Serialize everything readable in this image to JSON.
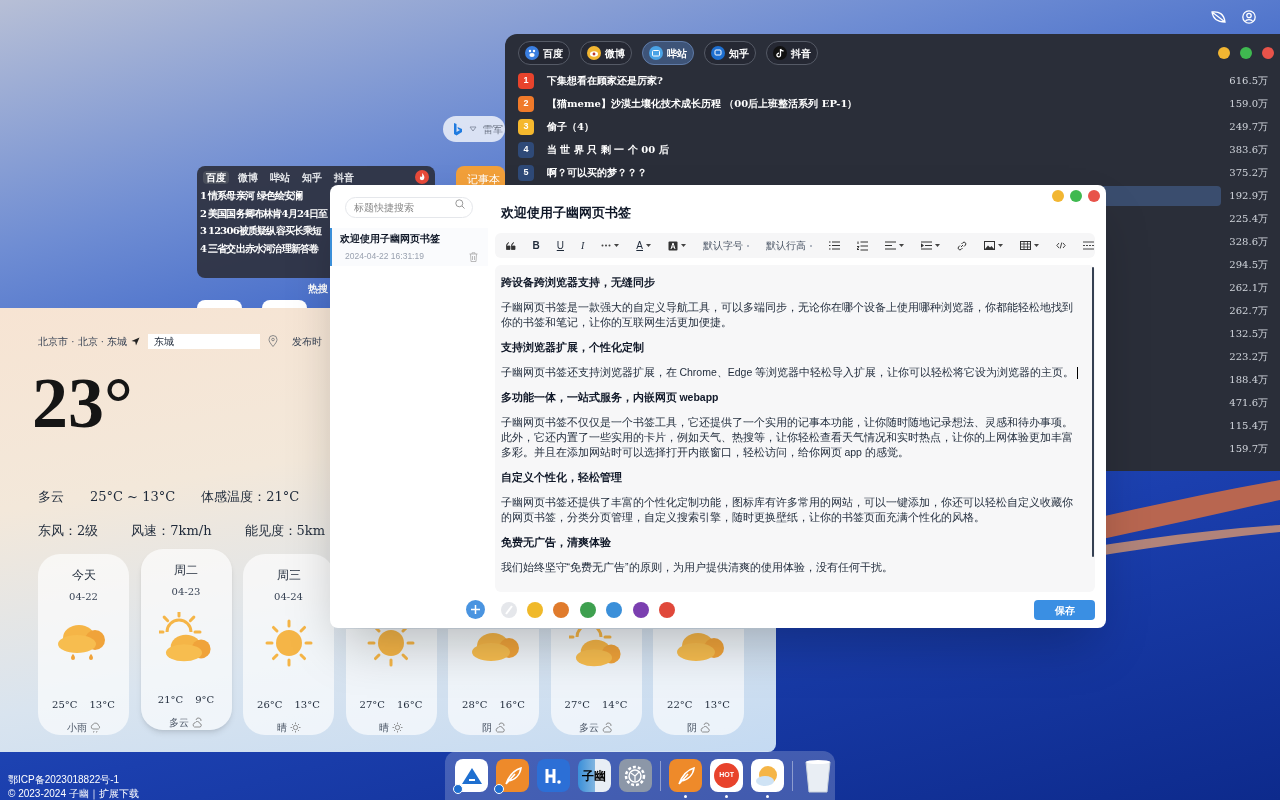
{
  "search_bar": {
    "query": "雷军"
  },
  "notepad_button": {
    "label": "记事本"
  },
  "hot_widget": {
    "tabs": [
      {
        "label": "百度",
        "selected": true
      },
      {
        "label": "微博",
        "selected": false
      },
      {
        "label": "哔站",
        "selected": false
      },
      {
        "label": "知乎",
        "selected": false
      },
      {
        "label": "抖音",
        "selected": false
      }
    ],
    "items": [
      {
        "rank": "1",
        "title": "情系母亲河 绿色绘安澜"
      },
      {
        "rank": "2",
        "title": "美国国务卿布林肯4月24日至"
      },
      {
        "rank": "3",
        "title": "12306被质疑纵容买长乘短"
      },
      {
        "rank": "4",
        "title": "三省交出赤水河治理新答卷"
      }
    ],
    "caption": "热搜"
  },
  "hot_window": {
    "tabs": [
      {
        "label": "百度",
        "selected": false
      },
      {
        "label": "微博",
        "selected": false
      },
      {
        "label": "哔站",
        "selected": true
      },
      {
        "label": "知乎",
        "selected": false
      },
      {
        "label": "抖音",
        "selected": false
      }
    ],
    "items": [
      {
        "rank": "1",
        "color": "#e8432c",
        "title": "下集想看在顾家还是厉家?",
        "heat": "616.5万",
        "selected": false
      },
      {
        "rank": "2",
        "color": "#f07a2a",
        "title": "【猫meme】沙漠土壤化技术成长历程 （00后上班整活系列 EP-1）",
        "heat": "159.0万",
        "selected": false
      },
      {
        "rank": "3",
        "color": "#f5b82e",
        "title": "偷子（4）",
        "heat": "249.7万",
        "selected": false
      },
      {
        "rank": "4",
        "color": "#2f4a78",
        "title": "当 世 界 只 剩 一 个 00 后",
        "heat": "383.6万",
        "selected": false
      },
      {
        "rank": "5",
        "color": "#2f4a78",
        "title": "啊？可以买的梦？？？",
        "heat": "375.2万",
        "selected": false
      },
      {
        "heat": "192.9万",
        "selected": true
      },
      {
        "heat": "225.4万",
        "selected": false
      },
      {
        "heat": "328.6万",
        "selected": false
      },
      {
        "heat": "294.5万",
        "selected": false
      },
      {
        "heat": "262.1万",
        "selected": false
      },
      {
        "heat": "262.7万",
        "selected": false
      },
      {
        "heat": "132.5万",
        "selected": false
      },
      {
        "heat": "223.2万",
        "selected": false
      },
      {
        "heat": "188.4万",
        "selected": false
      },
      {
        "heat": "471.6万",
        "selected": false
      },
      {
        "heat": "115.4万",
        "selected": false
      },
      {
        "heat": "159.7万",
        "selected": false
      }
    ]
  },
  "weather": {
    "location": "北京市 · 北京 · 东城",
    "city_input": "东城",
    "publish_label": "发布时",
    "temperature": "23°",
    "condition": "多云",
    "range": "25°C ~ 13°C",
    "feels_like": "体感温度：21°C",
    "wind": "东风：2级",
    "wind_speed": "风速：7km/h",
    "visibility": "能见度：5km",
    "days": [
      {
        "day": "今天",
        "date": "04-22",
        "kind": "rain",
        "high": "25°C",
        "low": "13°C",
        "label": "小雨",
        "hovered": false
      },
      {
        "day": "周二",
        "date": "04-23",
        "kind": "partly_cloudy",
        "high": "21°C",
        "low": "9°C",
        "label": "多云",
        "hovered": true
      },
      {
        "day": "周三",
        "date": "04-24",
        "kind": "sunny",
        "high": "26°C",
        "low": "13°C",
        "label": "晴",
        "hovered": false
      },
      {
        "kind": "sunny",
        "high": "27°C",
        "low": "16°C",
        "label": "晴",
        "hovered": false
      },
      {
        "kind": "overcast",
        "high": "28°C",
        "low": "16°C",
        "label": "阴",
        "hovered": false
      },
      {
        "kind": "partly_cloudy",
        "high": "27°C",
        "low": "14°C",
        "label": "多云",
        "hovered": false
      },
      {
        "kind": "overcast",
        "high": "22°C",
        "low": "13°C",
        "label": "阴",
        "hovered": false
      }
    ]
  },
  "notes_window": {
    "search_placeholder": "标题快捷搜索",
    "notes": [
      {
        "title": "欢迎使用子幽网页书签",
        "date": "2024-04-22 16:31:19",
        "selected": true
      }
    ],
    "title": "欢迎使用子幽网页书签",
    "toolbar": [
      {
        "kind": "quote",
        "dropdown": false
      },
      {
        "kind": "bold",
        "label": "B",
        "dropdown": false
      },
      {
        "kind": "underline",
        "label": "U",
        "dropdown": false
      },
      {
        "kind": "italic",
        "label": "I",
        "dropdown": false
      },
      {
        "kind": "more",
        "dropdown": true
      },
      {
        "kind": "font_color",
        "label": "A",
        "dropdown": true
      },
      {
        "kind": "highlight",
        "dropdown": true
      },
      {
        "kind": "select",
        "label": "默认字号",
        "dropdown": false
      },
      {
        "kind": "select",
        "label": "默认行高",
        "dropdown": false
      },
      {
        "kind": "bullet_list",
        "dropdown": false
      },
      {
        "kind": "ordered_list",
        "dropdown": false
      },
      {
        "kind": "align",
        "dropdown": true
      },
      {
        "kind": "indent",
        "dropdown": true
      },
      {
        "kind": "link",
        "dropdown": false
      },
      {
        "kind": "image",
        "dropdown": true
      },
      {
        "kind": "table",
        "dropdown": true
      },
      {
        "kind": "code",
        "dropdown": false
      },
      {
        "kind": "divider",
        "dropdown": false
      }
    ],
    "content": [
      {
        "kind": "heading",
        "text": "跨设备跨浏览器支持，无缝同步",
        "caret": false
      },
      {
        "kind": "body",
        "text": "子幽网页书签是一款强大的自定义导航工具，可以多端同步，无论你在哪个设备上使用哪种浏览器，你都能轻松地找到你的书签和笔记，让你的互联网生活更加便捷。",
        "caret": false
      },
      {
        "kind": "heading",
        "text": "支持浏览器扩展，个性化定制",
        "caret": false
      },
      {
        "kind": "body",
        "text": "子幽网页书签还支持浏览器扩展，在 Chrome、Edge 等浏览器中轻松导入扩展，让你可以轻松将它设为浏览器的主页。",
        "caret": true
      },
      {
        "kind": "heading",
        "text": "多功能一体，一站式服务，内嵌网页 webapp",
        "caret": false
      },
      {
        "kind": "body",
        "text": "子幽网页书签不仅仅是一个书签工具，它还提供了一个实用的记事本功能，让你随时随地记录想法、灵感和待办事项。此外，它还内置了一些实用的卡片，例如天气、热搜等，让你轻松查看天气情况和实时热点，让你的上网体验更加丰富多彩。并且在添加网站时可以选择打开内嵌窗口，轻松访问，给你网页 app 的感觉。",
        "caret": false
      },
      {
        "kind": "heading",
        "text": "自定义个性化，轻松管理",
        "caret": false
      },
      {
        "kind": "body",
        "text": "子幽网页书签还提供了丰富的个性化定制功能，图标库有许多常用的网站，可以一键添加，你还可以轻松自定义收藏你的网页书签，分类分页管理，自定义搜索引擎，随时更换壁纸，让你的书签页面充满个性化的风格。",
        "caret": false
      },
      {
        "kind": "heading",
        "text": "免费无广告，清爽体验",
        "caret": false
      },
      {
        "kind": "body",
        "text": "我们始终坚守“免费无广告”的原则，为用户提供清爽的使用体验，没有任何干扰。",
        "caret": false
      }
    ],
    "colors": [
      {
        "kind": "none"
      },
      {
        "kind": "color",
        "color": "#f0b92a"
      },
      {
        "kind": "color",
        "color": "#e07b2c"
      },
      {
        "kind": "color",
        "color": "#3ea04f"
      },
      {
        "kind": "color",
        "color": "#3a8fd9"
      },
      {
        "kind": "color",
        "color": "#7b3fb0"
      },
      {
        "kind": "color",
        "color": "#e0483a"
      }
    ],
    "save_button": "保存"
  },
  "footer": [
    "鄂ICP备2023018822号-1",
    "© 2023-2024 子幽｜扩展下载"
  ],
  "dock": [
    {
      "kind": "app_store",
      "running": false
    },
    {
      "kind": "feather_share",
      "running": false
    },
    {
      "kind": "h_logo",
      "running": false
    },
    {
      "kind": "ziyou_logo",
      "label": "子幽",
      "running": false
    },
    {
      "kind": "gear",
      "running": false
    },
    {
      "kind": "separator"
    },
    {
      "kind": "feather",
      "running": true
    },
    {
      "kind": "hot",
      "label": "HOT",
      "running": true
    },
    {
      "kind": "weather",
      "running": true
    },
    {
      "kind": "separator"
    },
    {
      "kind": "trash",
      "running": false
    }
  ]
}
